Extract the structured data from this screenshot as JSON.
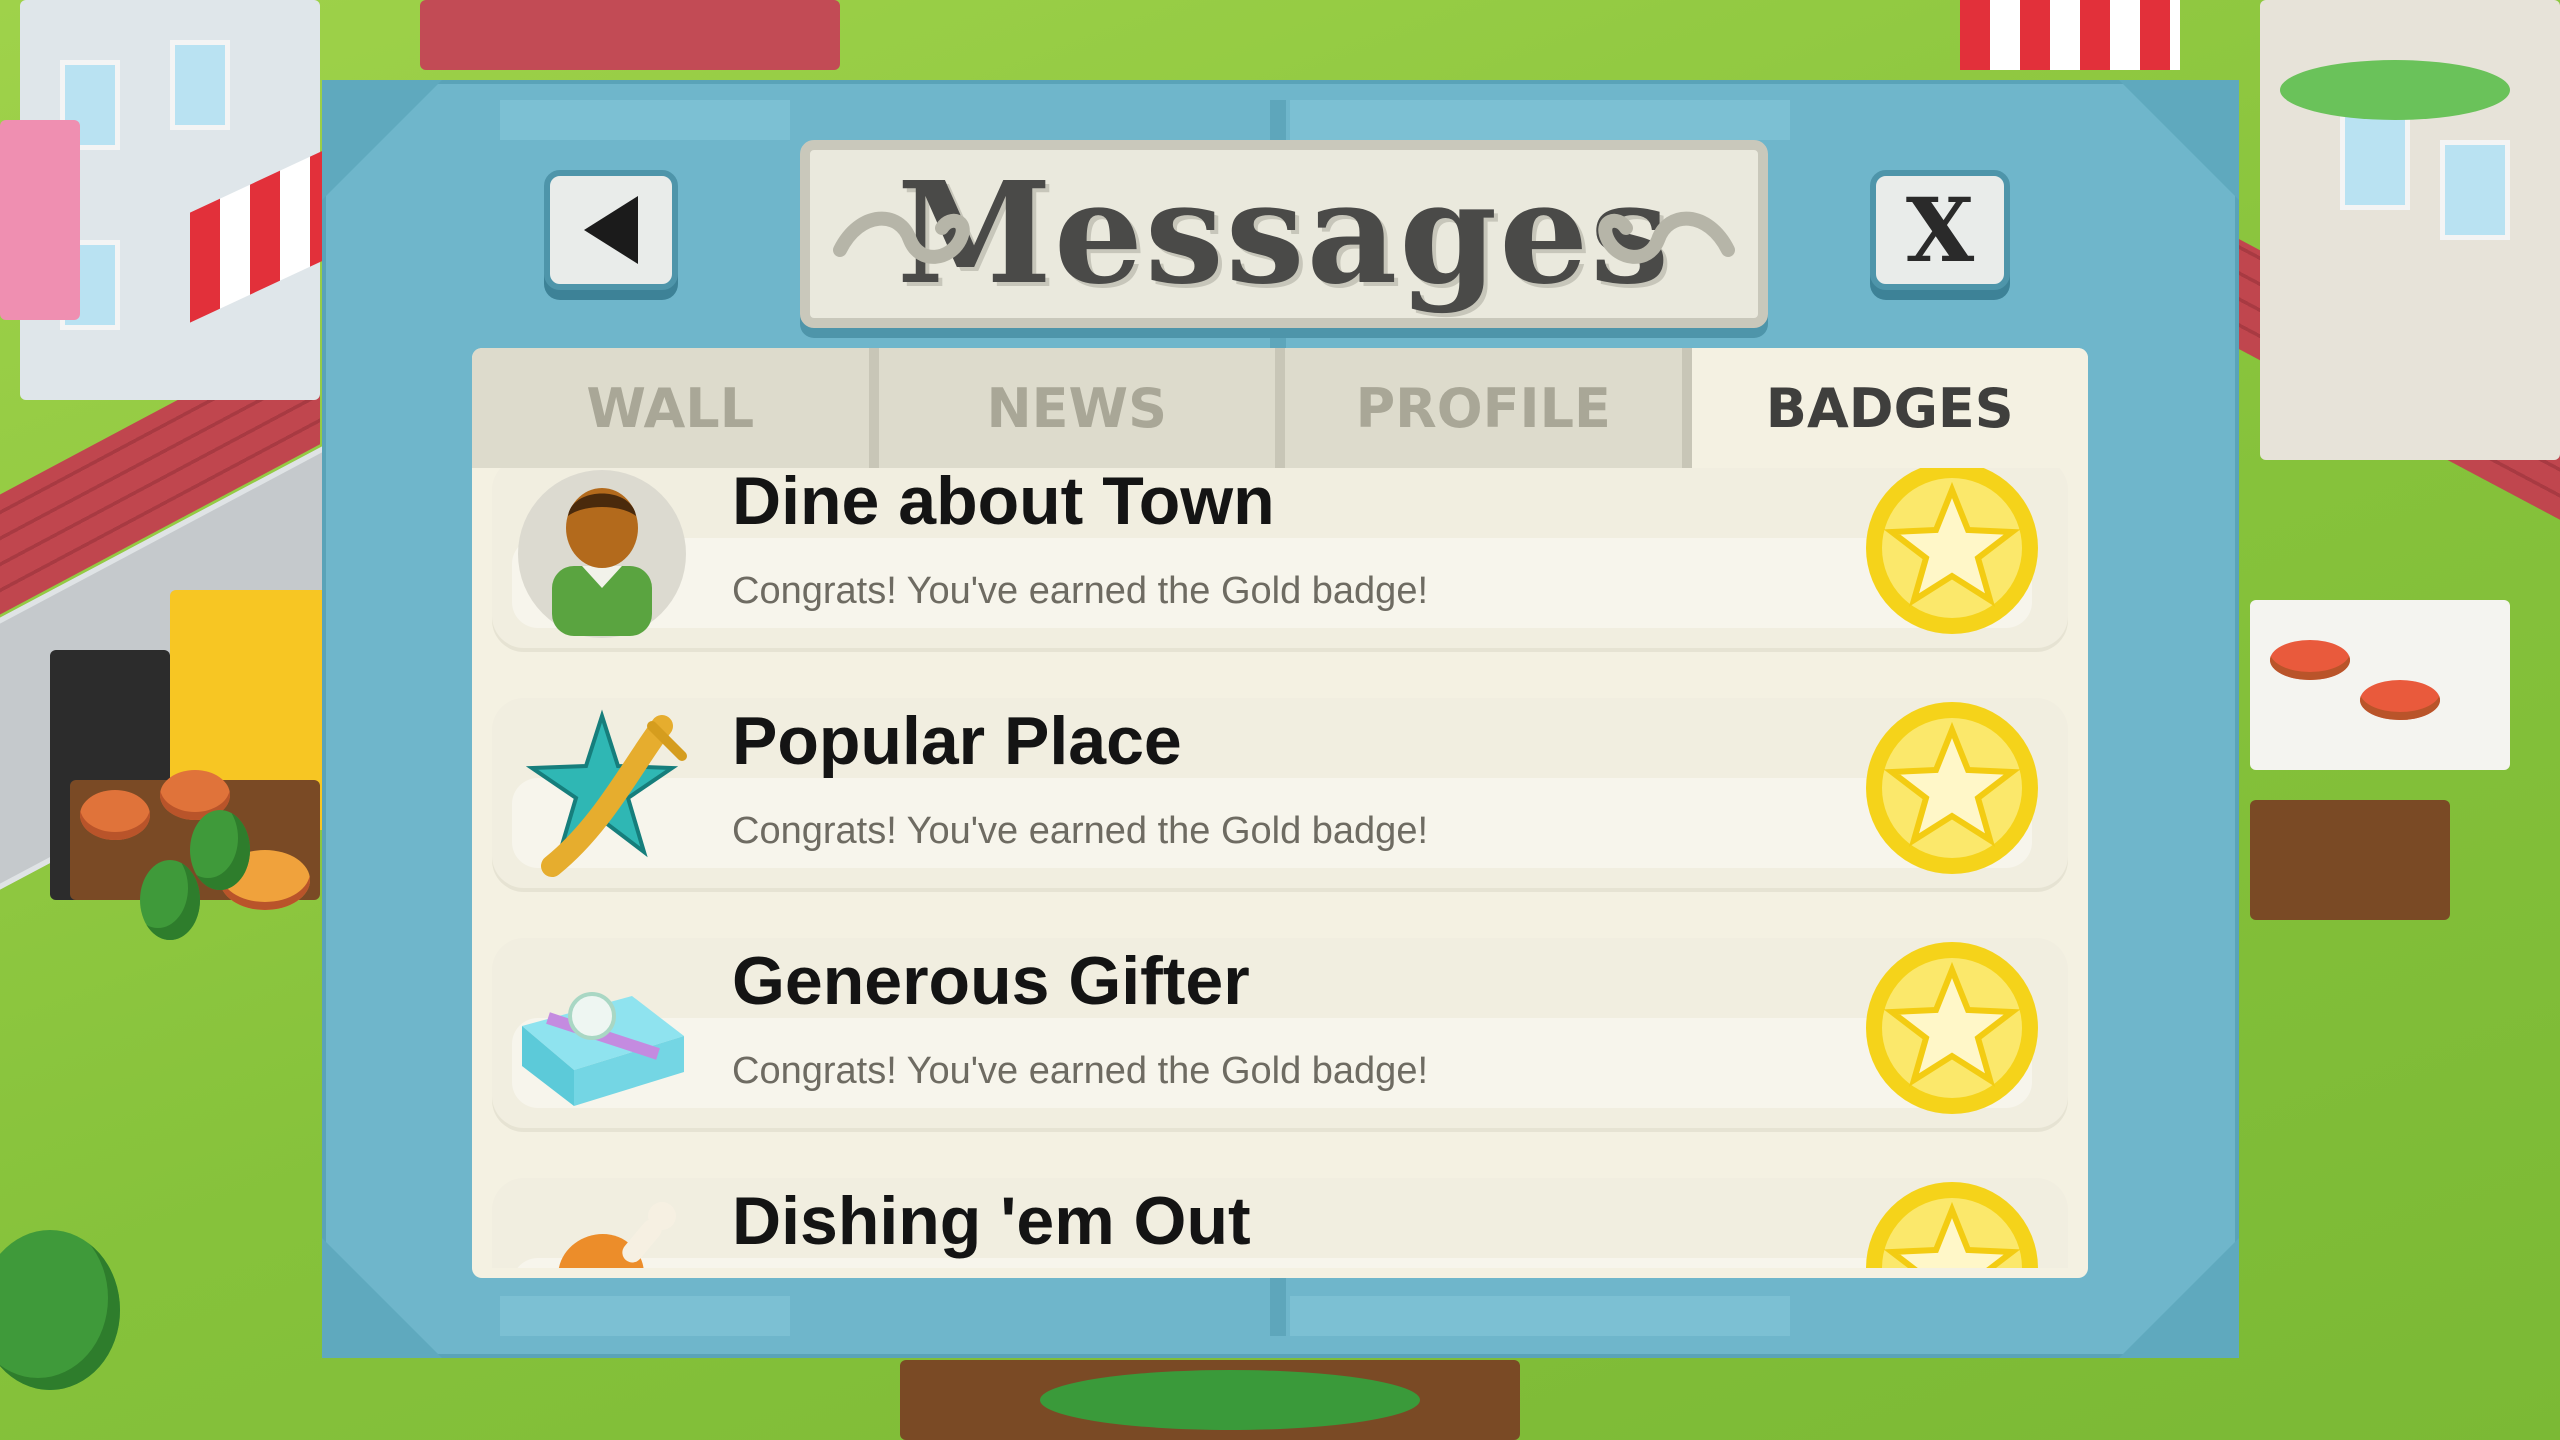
{
  "dialog": {
    "title": "Messages",
    "back_icon": "back-arrow-icon",
    "close_label": "X"
  },
  "tabs": [
    {
      "label": "WALL",
      "active": false
    },
    {
      "label": "NEWS",
      "active": false
    },
    {
      "label": "PROFILE",
      "active": false
    },
    {
      "label": "BADGES",
      "active": true
    }
  ],
  "badges": [
    {
      "title": "Dine about Town",
      "subtitle": "Congrats! You've earned the Gold badge!",
      "icon": "diner-person-icon",
      "badge_level": "Gold"
    },
    {
      "title": "Popular Place",
      "subtitle": "Congrats! You've earned the Gold badge!",
      "icon": "star-fork-icon",
      "badge_level": "Gold"
    },
    {
      "title": "Generous Gifter",
      "subtitle": "Congrats! You've earned the Gold badge!",
      "icon": "gift-box-icon",
      "badge_level": "Gold"
    },
    {
      "title": "Dishing 'em Out",
      "subtitle": "",
      "icon": "chicken-leg-icon",
      "badge_level": "Gold"
    }
  ],
  "colors": {
    "frame": "#6fb6cb",
    "panel": "#f4f1e2",
    "gold": "#f4d21c"
  }
}
